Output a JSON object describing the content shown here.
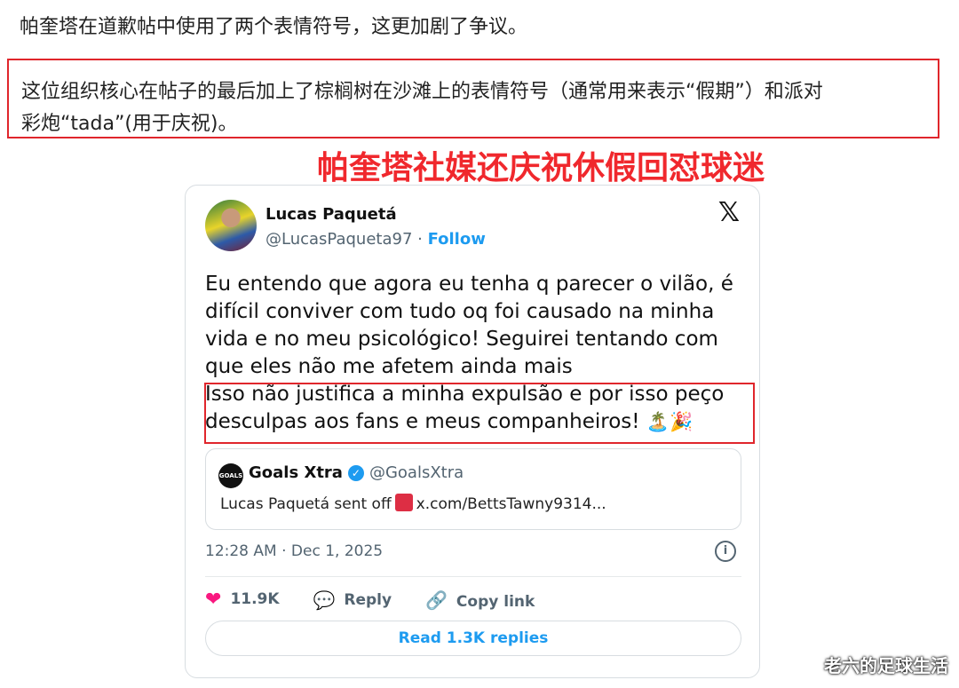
{
  "article": {
    "line1": "帕奎塔在道歉帖中使用了两个表情符号，这更加剧了争议。",
    "highlight_line1": "这位组织核心在帖子的最后加上了棕榈树在沙滩上的表情符号（通常用来表示“假期”）和派对",
    "highlight_line2": "彩炮“tada”(用于庆祝)。",
    "red_caption": "帕奎塔社媒还庆祝休假回怼球迷"
  },
  "tweet": {
    "author_name": "Lucas Paquetá",
    "author_handle": "@LucasPaqueta97",
    "separator": " · ",
    "follow_label": "Follow",
    "x_logo": "𝕏",
    "text_part1": "Eu entendo que agora eu tenha q parecer o vilão, é difícil conviver com tudo oq foi causado na minha vida e no meu psicológico! Seguirei tentando com que eles não me afetem ainda mais",
    "text_part2": "Isso não justifica a minha expulsão e por isso peço desculpas aos fans e meus companheiros!",
    "emojis": "🏝️🎉",
    "quote": {
      "avatar_text": "GOALS",
      "name": "Goals Xtra",
      "verified_icon": "✓",
      "handle": "@GoalsXtra",
      "text_before": "Lucas Paquetá sent off",
      "text_after": "x.com/BettsTawny9314..."
    },
    "timestamp": "12:28 AM · Dec 1, 2025",
    "info_icon": "i",
    "likes": "11.9K",
    "reply_label": "Reply",
    "copy_link_label": "Copy link",
    "read_replies_label": "Read 1.3K replies"
  },
  "watermark": "老六的足球生活",
  "colors": {
    "accent": "#1d9bf0",
    "highlight_border": "#e0262c",
    "caption_red": "#f0282d",
    "like": "#f91880"
  },
  "icons": {
    "like": "heart-icon",
    "reply": "speech-bubble-icon",
    "copy": "link-icon",
    "info": "info-icon",
    "brand": "x-logo-icon"
  }
}
